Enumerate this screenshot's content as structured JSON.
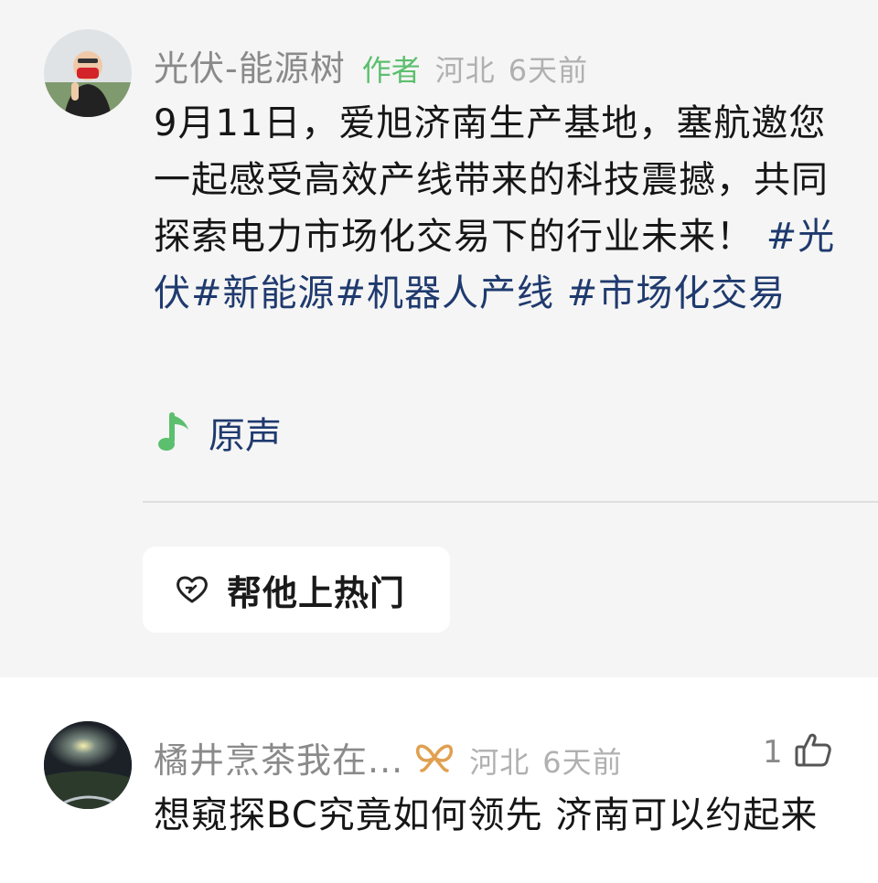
{
  "author_post": {
    "username": "光伏-能源树",
    "author_tag": "作者",
    "location": "河北",
    "time": "6天前",
    "text_parts": [
      "9月11日，爱旭济南生产基地，塞航邀您一起感受高效产线带来的科技震撼，共同探索电力市场化交易下的行业未来！",
      "#光伏",
      "#新能源",
      "#机器人产线",
      "#市场化交易"
    ],
    "sound": {
      "icon": "music-note-icon",
      "label": "原声"
    },
    "boost_button": {
      "icon": "heart-boost-icon",
      "label": "帮他上热门"
    }
  },
  "comment": {
    "username": "橘井烹茶我在...",
    "badge_icon": "butterfly-badge-icon",
    "location": "河北",
    "time": "6天前",
    "like_count": "1",
    "like_icon": "thumbs-up-icon",
    "text": "想窥探BC究竟如何领先 济南可以约起来"
  },
  "colors": {
    "author_tag": "#5cbf6e",
    "hashtag": "#1f3a6e",
    "meta": "#b0b0b0",
    "username": "#8a8a8a",
    "badge": "#e0a050",
    "author_bg": "#f5f5f5"
  }
}
